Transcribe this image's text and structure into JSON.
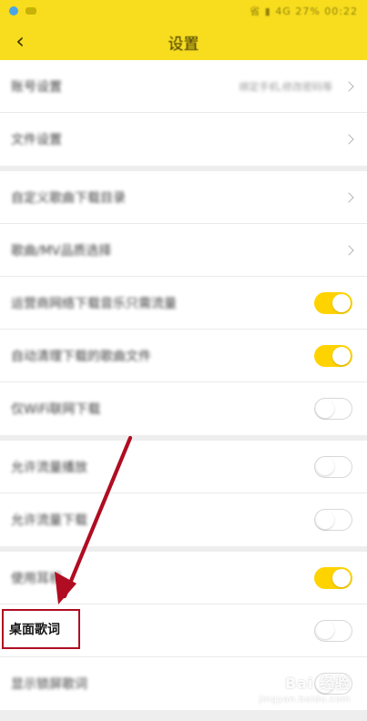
{
  "status_bar": {
    "right_text": "省 ▮ 4G 27% 00:22"
  },
  "appbar": {
    "title": "设置"
  },
  "groups": [
    {
      "items": [
        {
          "label": "账号设置",
          "value": "绑定手机,修改密码等",
          "control": "chevron"
        },
        {
          "label": "文件设置",
          "value": "",
          "control": "chevron"
        }
      ]
    },
    {
      "items": [
        {
          "label": "自定义歌曲下载目录",
          "value": "",
          "control": "chevron"
        },
        {
          "label": "歌曲/MV品质选择",
          "value": "",
          "control": "chevron"
        },
        {
          "label": "运营商网络下载音乐只需流量",
          "control": "toggle",
          "on": true
        },
        {
          "label": "自动清理下载的歌曲文件",
          "control": "toggle",
          "on": true
        },
        {
          "label": "仅WiFi联网下载",
          "control": "toggle",
          "on": false
        }
      ]
    },
    {
      "items": [
        {
          "label": "允许流量播放",
          "control": "toggle",
          "on": false
        },
        {
          "label": "允许流量下载",
          "control": "toggle",
          "on": false
        }
      ]
    },
    {
      "items": [
        {
          "label": "使用耳机",
          "control": "toggle",
          "on": true
        },
        {
          "label": "桌面歌词",
          "control": "toggle",
          "on": false
        },
        {
          "label": "显示锁屏歌词",
          "control": "toggle",
          "on": false
        }
      ]
    }
  ],
  "watermark": {
    "top": "Bai 经验",
    "bottom": "jingyan.baidu.com"
  },
  "colors": {
    "accent": "#ffd300",
    "annotation": "#b00d22"
  }
}
